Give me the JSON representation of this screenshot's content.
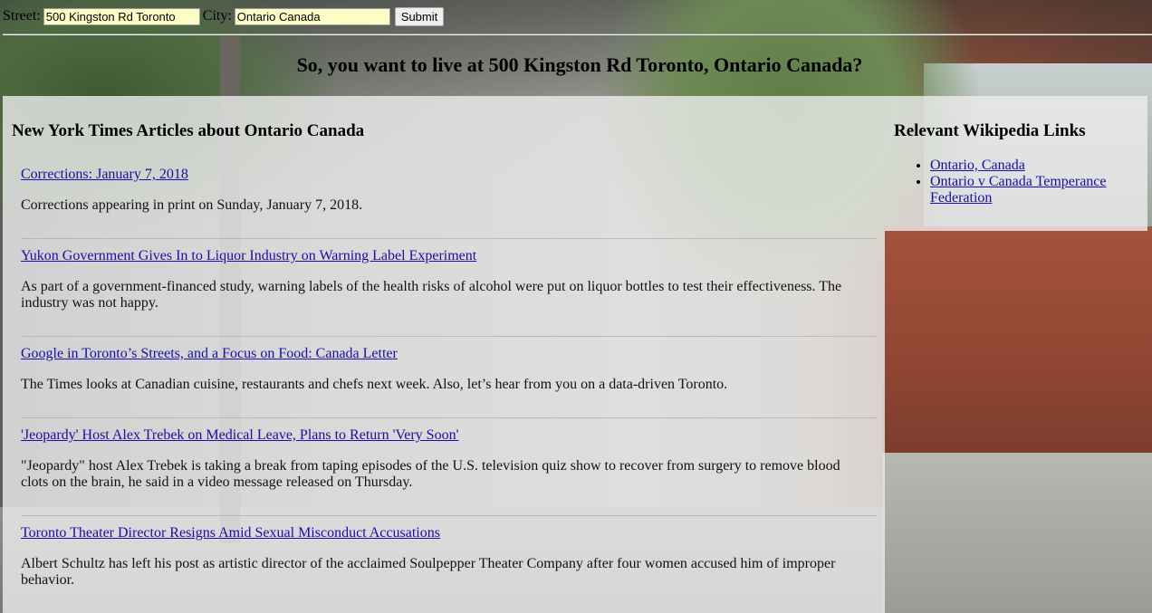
{
  "form": {
    "street_label": "Street:",
    "street_value": "500 Kingston Rd Toronto",
    "city_label": "City:",
    "city_value": "Ontario Canada",
    "submit_label": "Submit"
  },
  "page_title": "So, you want to live at 500 Kingston Rd Toronto, Ontario Canada?",
  "nyt": {
    "heading": "New York Times Articles about Ontario Canada",
    "articles": [
      {
        "title": "Corrections: January 7, 2018",
        "summary": "Corrections appearing in print on Sunday, January 7, 2018."
      },
      {
        "title": "Yukon Government Gives In to Liquor Industry on Warning Label Experiment",
        "summary": "As part of a government-financed study, warning labels of the health risks of alcohol were put on liquor bottles to test their effectiveness. The industry was not happy."
      },
      {
        "title": "Google in Toronto’s Streets, and a Focus on Food: Canada Letter",
        "summary": "The Times looks at Canadian cuisine, restaurants and chefs next week. Also, let’s hear from you on a data-driven Toronto."
      },
      {
        "title": "'Jeopardy' Host Alex Trebek on Medical Leave, Plans to Return 'Very Soon'",
        "summary": "\"Jeopardy\" host Alex Trebek is taking a break from taping episodes of the U.S. television quiz show to recover from surgery to remove blood clots on the brain, he said in a video message released on Thursday."
      },
      {
        "title": "Toronto Theater Director Resigns Amid Sexual Misconduct Accusations",
        "summary": "Albert Schultz has left his post as artistic director of the acclaimed Soulpepper Theater Company after four women accused him of improper behavior."
      }
    ]
  },
  "wiki": {
    "heading": "Relevant Wikipedia Links",
    "links": [
      "Ontario, Canada",
      "Ontario v Canada Temperance Federation"
    ]
  }
}
